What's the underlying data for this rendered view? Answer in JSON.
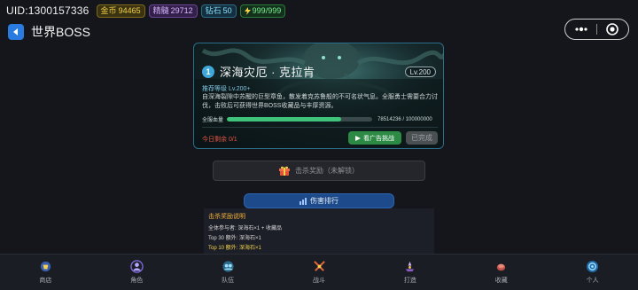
{
  "status_bar": {
    "uid": "UID:1300157336",
    "gold": {
      "label": "金币",
      "value": "94465"
    },
    "jade": {
      "label": "精髓",
      "value": "29712"
    },
    "diamond": {
      "label": "钻石",
      "value": "50"
    },
    "energy": {
      "value": "999/999",
      "icon": "lightning-icon"
    }
  },
  "header": {
    "title": "世界BOSS",
    "back_icon": "back-arrow-icon"
  },
  "capsule": {
    "more_icon": "more-dots-icon",
    "close_icon": "target-icon"
  },
  "boss": {
    "index": "1",
    "name": "深海灾厄 · 克拉肯",
    "level_badge": "Lv.200",
    "recommend": "推荐等级 Lv.200+",
    "description": "自深海裂隙中苏醒的巨型章鱼，散发着克苏鲁般的不可名状气息。全服勇士需要合力讨伐，击败后可获得世界BOSS收藏品与丰厚资源。",
    "hp_label": "全服血量",
    "hp_value": "78514236 / 100000000",
    "hp_fraction": 0.785,
    "remaining": "今日剩余 0/1",
    "ad_button": "看广告挑战",
    "done_button": "已完成"
  },
  "kill_reward": {
    "label": "击杀奖励（未解锁）",
    "icon": "gift-icon"
  },
  "ranking": {
    "label": "伤害排行",
    "icon": "chart-icon"
  },
  "rules": {
    "title": "击杀奖励说明",
    "lines": [
      "全体参与者: 深海石×1 + 收藏品",
      "Top 30 额外: 深海石×1",
      "Top 10 额外: 深海石×1"
    ]
  },
  "nav": [
    {
      "label": "商店",
      "icon": "shop-icon"
    },
    {
      "label": "角色",
      "icon": "character-icon"
    },
    {
      "label": "队伍",
      "icon": "team-icon"
    },
    {
      "label": "战斗",
      "icon": "battle-icon"
    },
    {
      "label": "打造",
      "icon": "forge-icon"
    },
    {
      "label": "收藏",
      "icon": "collection-icon"
    },
    {
      "label": "个人",
      "icon": "profile-icon"
    }
  ],
  "colors": {
    "background": "#15161c",
    "accent_blue": "#2a7be0",
    "hp_green": "#3fc27a",
    "warning_red": "#e45545",
    "gold": "#f4d34a"
  }
}
